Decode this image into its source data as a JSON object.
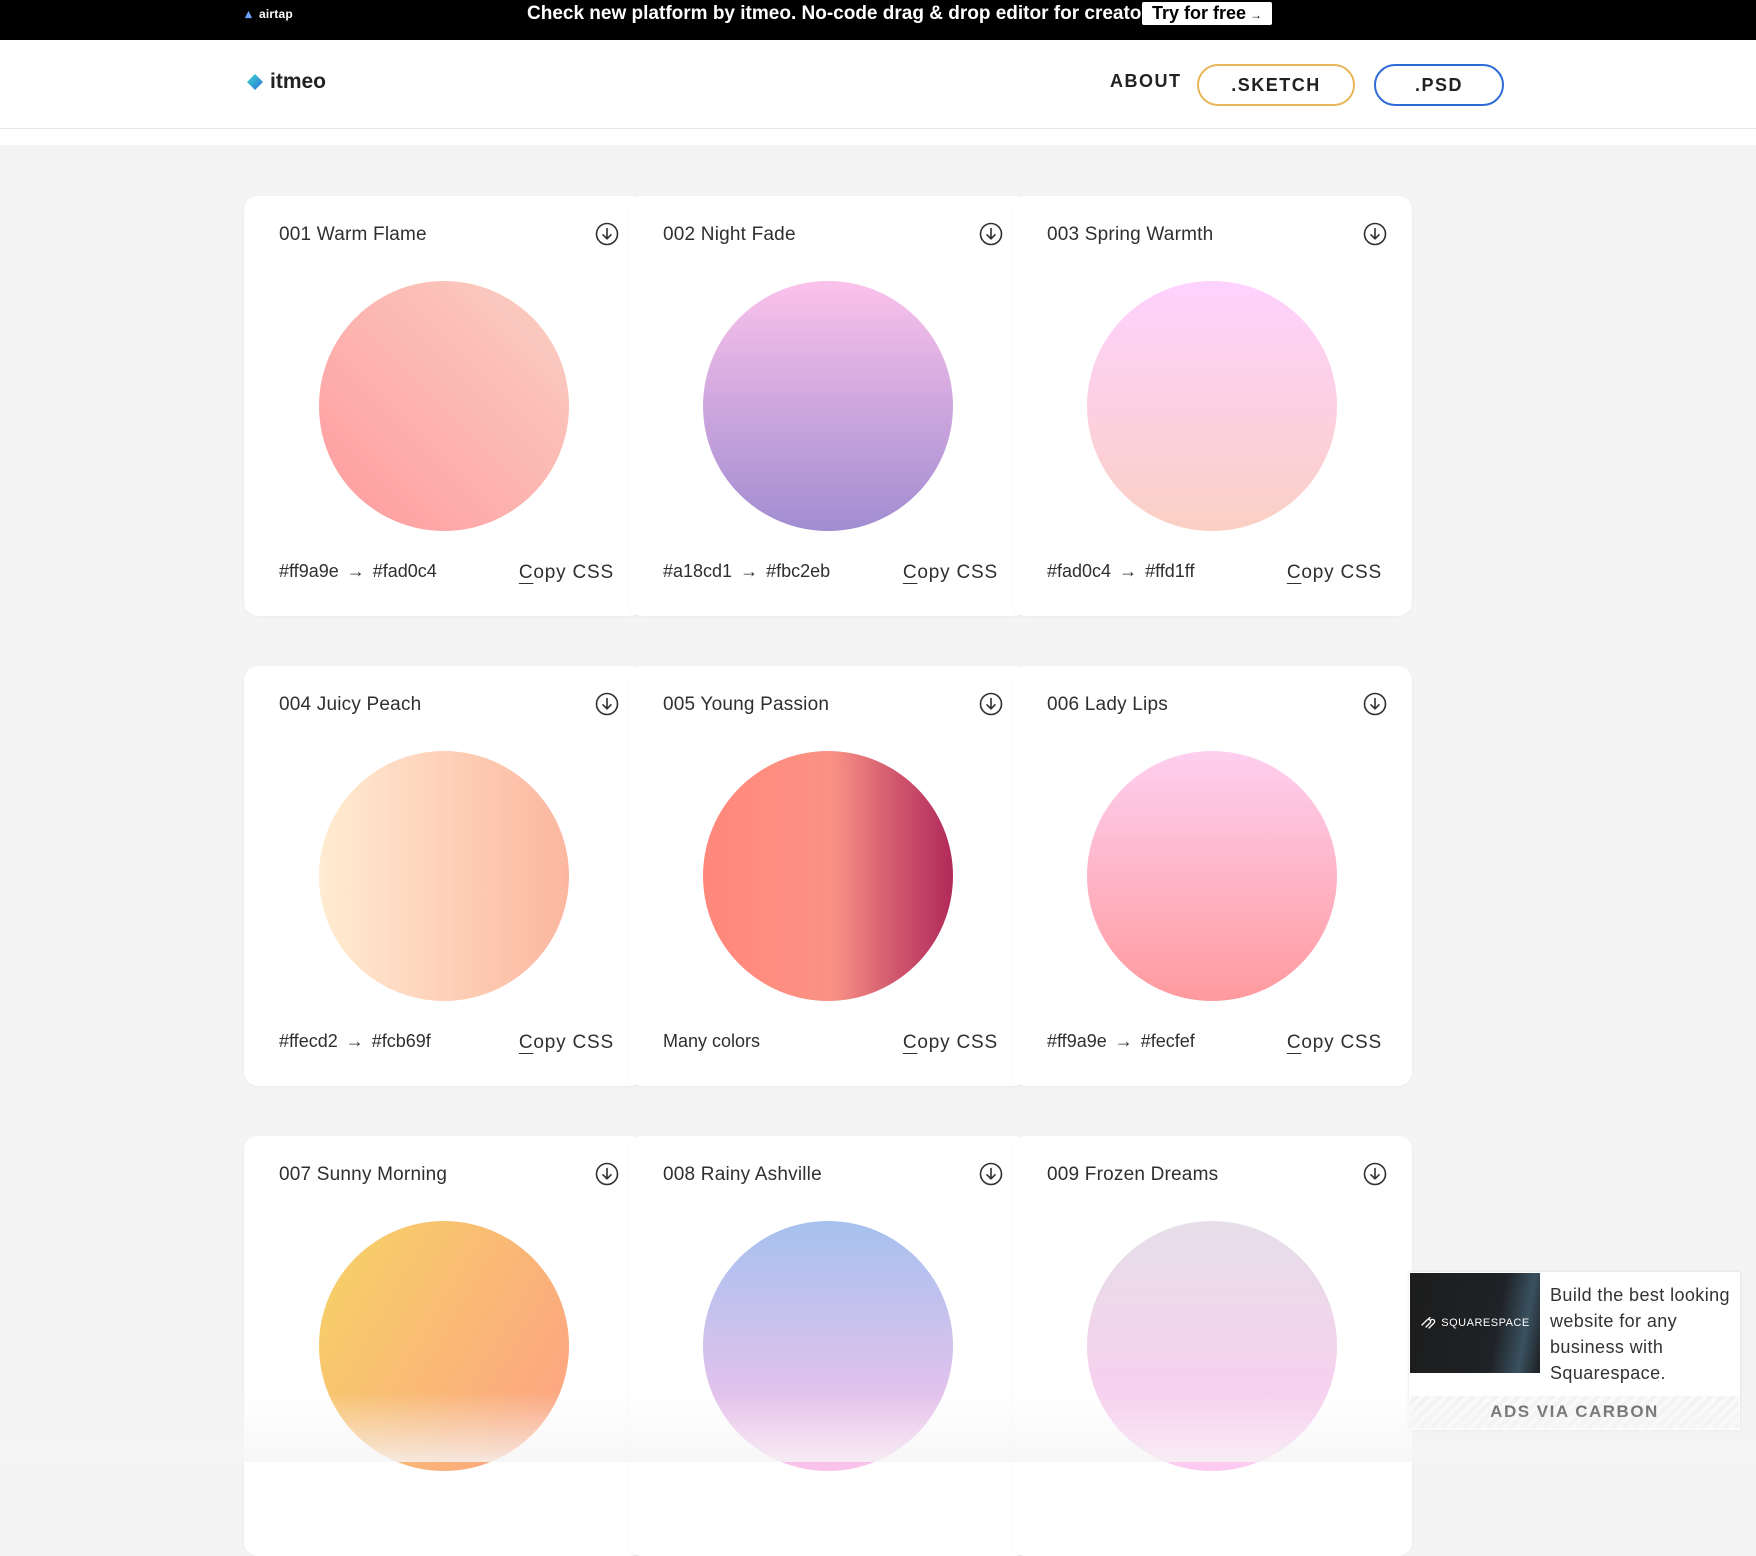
{
  "banner": {
    "logo_text": "airtap",
    "message": "Check new platform by itmeo. No-code drag & drop editor for creators.",
    "cta_label": "Try for free",
    "cta_arrow": "→"
  },
  "header": {
    "brand": "itmeo",
    "nav": {
      "about": "ABOUT",
      "sketch": ".SKETCH",
      "psd": ".PSD"
    },
    "colors": {
      "sketch_border": "#e8b65a",
      "psd_border": "#2e6bd6"
    }
  },
  "cards": [
    {
      "title": "001 Warm Flame",
      "from": "#ff9a9e",
      "arrow": "→",
      "to": "#fad0c4",
      "note": "",
      "copy_first": "C",
      "copy_rest": "opy CSS",
      "gradient": "linear-gradient(45deg, #ff9a9e 0%, #fad0c4 99%, #fad0c4 100%)"
    },
    {
      "title": "002 Night Fade",
      "from": "#a18cd1",
      "arrow": "→",
      "to": "#fbc2eb",
      "note": "",
      "copy_first": "C",
      "copy_rest": "opy CSS",
      "gradient": "linear-gradient(to top, #a18cd1 0%, #fbc2eb 100%)"
    },
    {
      "title": "003 Spring Warmth",
      "from": "#fad0c4",
      "arrow": "→",
      "to": "#ffd1ff",
      "note": "",
      "copy_first": "C",
      "copy_rest": "opy CSS",
      "gradient": "linear-gradient(to top, #fad0c4 0%, #ffd1ff 100%)"
    },
    {
      "title": "004 Juicy Peach",
      "from": "#ffecd2",
      "arrow": "→",
      "to": "#fcb69f",
      "note": "",
      "copy_first": "C",
      "copy_rest": "opy CSS",
      "gradient": "linear-gradient(to right, #ffecd2 0%, #fcb69f 100%)"
    },
    {
      "title": "005 Young Passion",
      "from": "",
      "arrow": "",
      "to": "",
      "note": "Many colors",
      "copy_first": "C",
      "copy_rest": "opy CSS",
      "gradient": "linear-gradient(to right, #ff8177 0%, #ff867a 0%, #ff8c7f 21%, #f99185 52%, #cf556c 78%, #b12a5b 100%)"
    },
    {
      "title": "006 Lady Lips",
      "from": "#ff9a9e",
      "arrow": "→",
      "to": "#fecfef",
      "note": "",
      "copy_first": "C",
      "copy_rest": "opy CSS",
      "gradient": "linear-gradient(to top, #ff9a9e 0%, #fecfef 99%, #fecfef 100%)"
    },
    {
      "title": "007 Sunny Morning",
      "from": "",
      "arrow": "",
      "to": "",
      "note": "",
      "copy_first": "",
      "copy_rest": "",
      "gradient": "linear-gradient(120deg, #f6d365 0%, #fda085 100%)"
    },
    {
      "title": "008 Rainy Ashville",
      "from": "",
      "arrow": "",
      "to": "",
      "note": "",
      "copy_first": "",
      "copy_rest": "",
      "gradient": "linear-gradient(to top, #fbc2eb 0%, #a6c1ee 100%)"
    },
    {
      "title": "009 Frozen Dreams",
      "from": "",
      "arrow": "",
      "to": "",
      "note": "",
      "copy_first": "",
      "copy_rest": "",
      "gradient": "linear-gradient(to top, #fdcbf1 0%, #fdcbf1 1%, #e6dee9 100%)"
    }
  ],
  "ad": {
    "brand": "SQUARESPACE",
    "text": "Build the best looking website for any business with Squarespace.",
    "via": "ADS VIA CARBON"
  }
}
